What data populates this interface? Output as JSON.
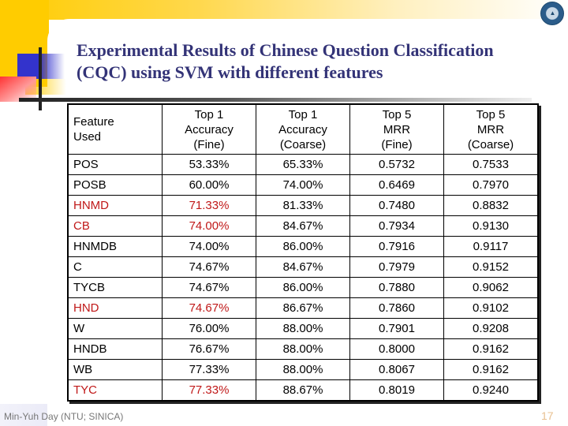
{
  "slide": {
    "title_line1": "Experimental Results of Chinese Question Classification",
    "title_line2": "(CQC) using SVM with different features",
    "footer_author": "Min-Yuh Day (NTU; SINICA)",
    "page_number": "17",
    "logo_icon": "institution-seal-icon",
    "highlight_color": "#c01818",
    "title_color": "#333377"
  },
  "table": {
    "headers": [
      {
        "line1": "Feature",
        "line2": "Used",
        "line3": ""
      },
      {
        "line1": "Top 1",
        "line2": "Accuracy",
        "line3": "(Fine)"
      },
      {
        "line1": "Top 1",
        "line2": "Accuracy",
        "line3": "(Coarse)"
      },
      {
        "line1": "Top 5",
        "line2": "MRR",
        "line3": "(Fine)"
      },
      {
        "line1": "Top 5",
        "line2": "MRR",
        "line3": "(Coarse)"
      }
    ],
    "rows": [
      {
        "feature": "POS",
        "top1_fine": "53.33%",
        "top1_coarse": "65.33%",
        "top5_fine": "0.5732",
        "top5_coarse": "0.7533",
        "highlighted": false
      },
      {
        "feature": "POSB",
        "top1_fine": "60.00%",
        "top1_coarse": "74.00%",
        "top5_fine": "0.6469",
        "top5_coarse": "0.7970",
        "highlighted": false
      },
      {
        "feature": "HNMD",
        "top1_fine": "71.33%",
        "top1_coarse": "81.33%",
        "top5_fine": "0.7480",
        "top5_coarse": "0.8832",
        "highlighted": true
      },
      {
        "feature": "CB",
        "top1_fine": "74.00%",
        "top1_coarse": "84.67%",
        "top5_fine": "0.7934",
        "top5_coarse": "0.9130",
        "highlighted": true
      },
      {
        "feature": "HNMDB",
        "top1_fine": "74.00%",
        "top1_coarse": "86.00%",
        "top5_fine": "0.7916",
        "top5_coarse": "0.9117",
        "highlighted": false
      },
      {
        "feature": "C",
        "top1_fine": "74.67%",
        "top1_coarse": "84.67%",
        "top5_fine": "0.7979",
        "top5_coarse": "0.9152",
        "highlighted": false
      },
      {
        "feature": "TYCB",
        "top1_fine": "74.67%",
        "top1_coarse": "86.00%",
        "top5_fine": "0.7880",
        "top5_coarse": "0.9062",
        "highlighted": false
      },
      {
        "feature": "HND",
        "top1_fine": "74.67%",
        "top1_coarse": "86.67%",
        "top5_fine": "0.7860",
        "top5_coarse": "0.9102",
        "highlighted": true
      },
      {
        "feature": "W",
        "top1_fine": "76.00%",
        "top1_coarse": "88.00%",
        "top5_fine": "0.7901",
        "top5_coarse": "0.9208",
        "highlighted": false
      },
      {
        "feature": "HNDB",
        "top1_fine": "76.67%",
        "top1_coarse": "88.00%",
        "top5_fine": "0.8000",
        "top5_coarse": "0.9162",
        "highlighted": false
      },
      {
        "feature": "WB",
        "top1_fine": "77.33%",
        "top1_coarse": "88.00%",
        "top5_fine": "0.8067",
        "top5_coarse": "0.9162",
        "highlighted": false
      },
      {
        "feature": "TYC",
        "top1_fine": "77.33%",
        "top1_coarse": "88.67%",
        "top5_fine": "0.8019",
        "top5_coarse": "0.9240",
        "highlighted": true
      }
    ]
  }
}
